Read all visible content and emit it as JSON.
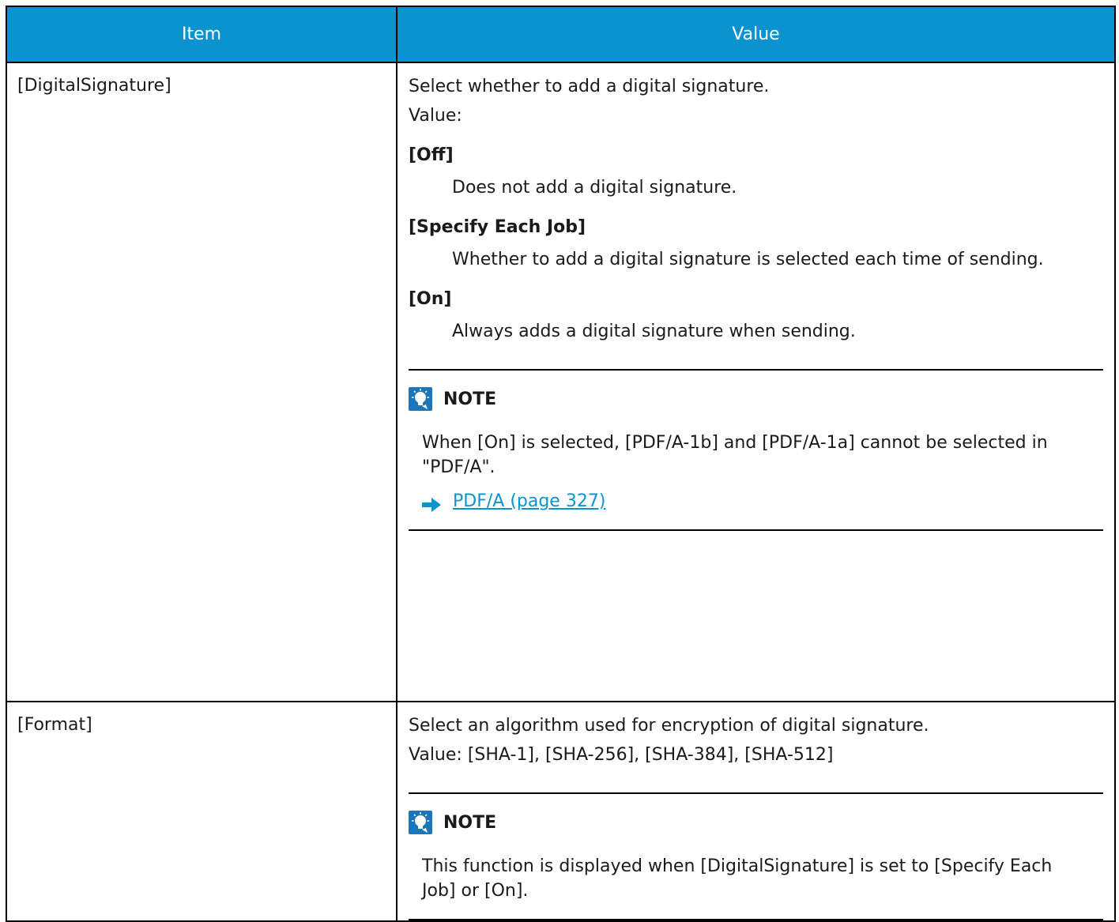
{
  "table": {
    "headers": {
      "item": "Item",
      "value": "Value"
    },
    "rows": [
      {
        "item": "[DigitalSignature]",
        "intro": "Select whether to add a digital signature.",
        "value_label": "Value:",
        "options": [
          {
            "title": "[Off]",
            "desc": "Does not add a digital signature."
          },
          {
            "title": "[Specify Each Job]",
            "desc": "Whether to add a digital signature is selected each time of sending."
          },
          {
            "title": "[On]",
            "desc": "Always adds a digital signature when sending."
          }
        ],
        "note": {
          "title": "NOTE",
          "text": "When [On] is selected, [PDF/A-1b] and [PDF/A-1a] cannot be selected in \"PDF/A\".",
          "link": "PDF/A (page 327)"
        }
      },
      {
        "item": "[Format]",
        "intro": "Select an algorithm used for encryption of digital signature.",
        "value_label": "Value: [SHA-1], [SHA-256], [SHA-384], [SHA-512]",
        "note": {
          "title": "NOTE",
          "text": "This function is displayed when [DigitalSignature] is set to [Specify Each Job] or [On]."
        }
      }
    ]
  },
  "colors": {
    "header_bg": "#0b93cf",
    "header_text": "#ffffff",
    "link": "#0b93cf",
    "icon_bg": "#1b75b8"
  },
  "icons": {
    "note": "lightbulb-icon",
    "link_arrow": "arrow-right-icon"
  }
}
